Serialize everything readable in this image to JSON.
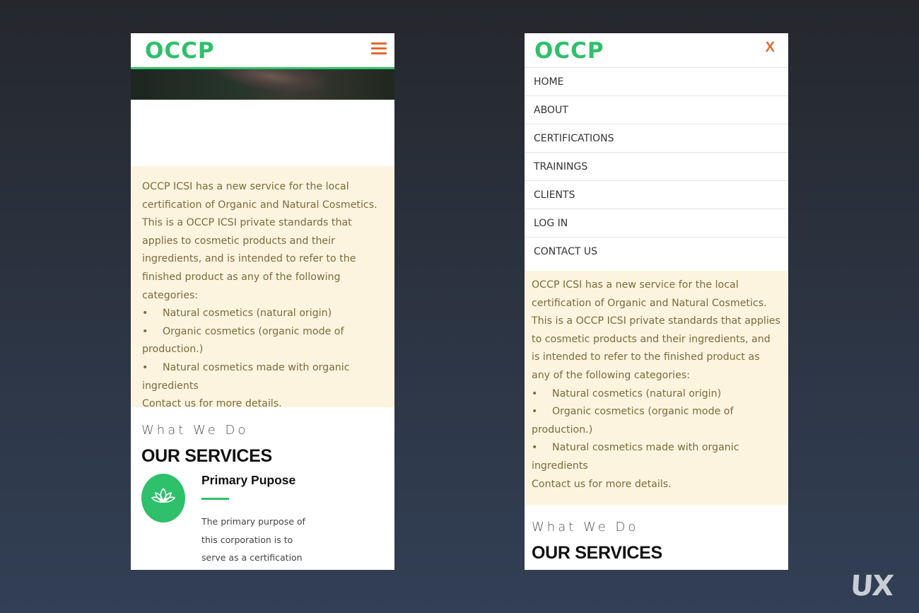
{
  "left_screen": {
    "logo": "OCCP",
    "menu_icon": "hamburger-menu-icon",
    "notice": {
      "intro": "OCCP ICSI has a new service for the local certification of Organic and Natural Cosmetics.  This is a OCCP ICSI private standards that applies to cosmetic products and their ingredients, and is intended to refer to the finished product as any of the following categories:",
      "bullets": [
        "Natural cosmetics (natural origin)",
        "Organic cosmetics (organic mode of production.)",
        "Natural cosmetics made with organic ingredients"
      ],
      "bullet_symbol": "•",
      "contact": "Contact us for more details."
    },
    "section": {
      "kicker": "What We Do",
      "title": "OUR SERVICES"
    },
    "service": {
      "icon": "lotus-icon",
      "title": "Primary Pupose",
      "text": "The primary purpose of this corporation is to serve as a certification and"
    }
  },
  "right_screen": {
    "logo": "OCCP",
    "close_label": "X",
    "menu": [
      "HOME",
      "ABOUT",
      "CERTIFICATIONS",
      "TRAININGS",
      "CLIENTS",
      "LOG IN",
      "CONTACT US"
    ],
    "notice": {
      "intro": "OCCP ICSI has a new service for the local certification of Organic and Natural Cosmetics.  This is a OCCP ICSI private standards that applies to cosmetic products and their ingredients, and is intended to refer to the finished product as any of the following categories:",
      "bullets": [
        "Natural cosmetics (natural origin)",
        "Organic cosmetics (organic mode of production.)",
        "Natural cosmetics made with organic ingredients"
      ],
      "bullet_symbol": "•",
      "contact": "Contact us for more details."
    },
    "section": {
      "kicker": "What We Do",
      "title": "OUR SERVICES"
    }
  },
  "watermark": "UX",
  "colors": {
    "brand_green": "#2ec06a",
    "accent_orange": "#e0692f",
    "notice_bg": "#fcf4df",
    "notice_text": "#7d6a3c"
  }
}
